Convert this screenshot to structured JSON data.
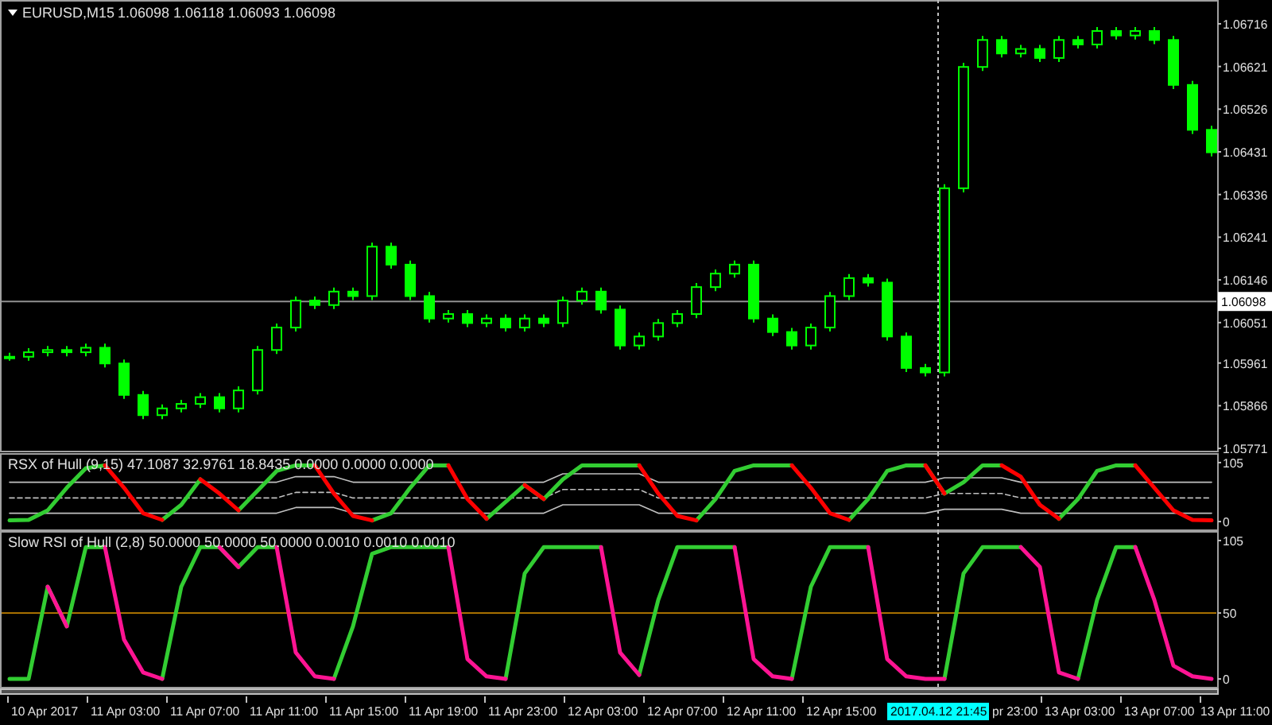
{
  "price_pane": {
    "symbol": "EURUSD,M15",
    "quote": "1.06098 1.06118 1.06093 1.06098",
    "chart_data": {
      "type": "candlestick",
      "ylim": [
        1.05764,
        1.06769
      ],
      "ohlc": [
        [
          1.05975,
          1.05984,
          1.05966,
          1.05975
        ],
        [
          1.05975,
          1.05994,
          1.05966,
          1.05985
        ],
        [
          1.05985,
          1.05999,
          1.05976,
          1.0599
        ],
        [
          1.0599,
          1.05999,
          1.05976,
          1.05985
        ],
        [
          1.05985,
          1.06004,
          1.05976,
          1.05995
        ],
        [
          1.05995,
          1.06004,
          1.05951,
          1.0596
        ],
        [
          1.0596,
          1.05969,
          1.05881,
          1.0589
        ],
        [
          1.0589,
          1.05899,
          1.05836,
          1.05845
        ],
        [
          1.05845,
          1.05869,
          1.05836,
          1.0586
        ],
        [
          1.0586,
          1.05879,
          1.05851,
          1.0587
        ],
        [
          1.0587,
          1.05894,
          1.05861,
          1.05885
        ],
        [
          1.05885,
          1.05894,
          1.05851,
          1.0586
        ],
        [
          1.0586,
          1.05909,
          1.05851,
          1.059
        ],
        [
          1.059,
          1.05999,
          1.05891,
          1.0599
        ],
        [
          1.0599,
          1.06049,
          1.05981,
          1.0604
        ],
        [
          1.0604,
          1.06109,
          1.06031,
          1.061
        ],
        [
          1.061,
          1.06109,
          1.06081,
          1.0609
        ],
        [
          1.0609,
          1.06129,
          1.06081,
          1.0612
        ],
        [
          1.0612,
          1.06129,
          1.06101,
          1.0611
        ],
        [
          1.0611,
          1.06229,
          1.06101,
          1.0622
        ],
        [
          1.0622,
          1.06229,
          1.06171,
          1.0618
        ],
        [
          1.0618,
          1.06189,
          1.06101,
          1.0611
        ],
        [
          1.0611,
          1.06119,
          1.06051,
          1.0606
        ],
        [
          1.0606,
          1.06079,
          1.06051,
          1.0607
        ],
        [
          1.0607,
          1.06079,
          1.06041,
          1.0605
        ],
        [
          1.0605,
          1.06069,
          1.06041,
          1.0606
        ],
        [
          1.0606,
          1.06069,
          1.06031,
          1.0604
        ],
        [
          1.0604,
          1.06069,
          1.06031,
          1.0606
        ],
        [
          1.0606,
          1.06069,
          1.06041,
          1.0605
        ],
        [
          1.0605,
          1.06109,
          1.06041,
          1.061
        ],
        [
          1.061,
          1.06129,
          1.06091,
          1.0612
        ],
        [
          1.0612,
          1.06129,
          1.06071,
          1.0608
        ],
        [
          1.0608,
          1.06089,
          1.05991,
          1.06
        ],
        [
          1.06,
          1.06029,
          1.05991,
          1.0602
        ],
        [
          1.0602,
          1.06059,
          1.06011,
          1.0605
        ],
        [
          1.0605,
          1.06079,
          1.06041,
          1.0607
        ],
        [
          1.0607,
          1.06139,
          1.06061,
          1.0613
        ],
        [
          1.0613,
          1.06169,
          1.06121,
          1.0616
        ],
        [
          1.0616,
          1.06189,
          1.06151,
          1.0618
        ],
        [
          1.0618,
          1.06189,
          1.06051,
          1.0606
        ],
        [
          1.0606,
          1.06069,
          1.06021,
          1.0603
        ],
        [
          1.0603,
          1.06039,
          1.05991,
          1.06
        ],
        [
          1.06,
          1.06049,
          1.05991,
          1.0604
        ],
        [
          1.0604,
          1.06119,
          1.06031,
          1.0611
        ],
        [
          1.0611,
          1.06159,
          1.06101,
          1.0615
        ],
        [
          1.0615,
          1.06159,
          1.06131,
          1.0614
        ],
        [
          1.0614,
          1.06149,
          1.06011,
          1.0602
        ],
        [
          1.0602,
          1.06029,
          1.05941,
          1.0595
        ],
        [
          1.0595,
          1.05959,
          1.05931,
          1.0594
        ],
        [
          1.0594,
          1.06359,
          1.05931,
          1.0635
        ],
        [
          1.0635,
          1.06629,
          1.06341,
          1.0662
        ],
        [
          1.0662,
          1.06689,
          1.06611,
          1.0668
        ],
        [
          1.0668,
          1.06689,
          1.06641,
          1.0665
        ],
        [
          1.0665,
          1.06669,
          1.06641,
          1.0666
        ],
        [
          1.0666,
          1.06669,
          1.06631,
          1.0664
        ],
        [
          1.0664,
          1.06689,
          1.06631,
          1.0668
        ],
        [
          1.0668,
          1.06689,
          1.06661,
          1.0667
        ],
        [
          1.0667,
          1.06709,
          1.06661,
          1.067
        ],
        [
          1.067,
          1.06709,
          1.06681,
          1.0669
        ],
        [
          1.0669,
          1.06709,
          1.06681,
          1.067
        ],
        [
          1.067,
          1.06709,
          1.06671,
          1.0668
        ],
        [
          1.0668,
          1.06689,
          1.06571,
          1.0658
        ],
        [
          1.0658,
          1.06589,
          1.06471,
          1.0648
        ],
        [
          1.0648,
          1.06489,
          1.06421,
          1.0643
        ]
      ],
      "yticks": [
        {
          "value": 1.06716,
          "label": "1.06716"
        },
        {
          "value": 1.06621,
          "label": "1.06621"
        },
        {
          "value": 1.06526,
          "label": "1.06526"
        },
        {
          "value": 1.06431,
          "label": "1.06431"
        },
        {
          "value": 1.06336,
          "label": "1.06336"
        },
        {
          "value": 1.06241,
          "label": "1.06241"
        },
        {
          "value": 1.06146,
          "label": "1.06146"
        },
        {
          "value": 1.06051,
          "label": "1.06051"
        },
        {
          "value": 1.05961,
          "label": "1.05961"
        },
        {
          "value": 1.05866,
          "label": "1.05866"
        },
        {
          "value": 1.05771,
          "label": "1.05771"
        }
      ],
      "ref_lines": [
        {
          "axis": "y",
          "value": 1.06098,
          "label": "1.06098"
        }
      ]
    }
  },
  "indicator_panes": [
    {
      "title": "RSX of Hull (9,15) 47.1087 32.9761 18.8435 0.0000 0.0000 0.0000",
      "chart_data": {
        "type": "line",
        "ylim": [
          -14,
          119
        ],
        "series": [
          {
            "color": "#c0c0c0",
            "line_style": "solid",
            "values": [
              70,
              70,
              70,
              70,
              70,
              70,
              70,
              70,
              70,
              70,
              70,
              70,
              70,
              70,
              70,
              80,
              80,
              80,
              70,
              70,
              70,
              70,
              70,
              70,
              70,
              70,
              70,
              70,
              70,
              85,
              85,
              85,
              85,
              85,
              70,
              70,
              70,
              70,
              70,
              70,
              70,
              70,
              70,
              70,
              70,
              70,
              70,
              70,
              70,
              78,
              78,
              78,
              78,
              70,
              70,
              70,
              70,
              70,
              70,
              70,
              70,
              70,
              70,
              70
            ]
          },
          {
            "color": "#c0c0c0",
            "line_style": "dashed",
            "values": [
              42,
              42,
              42,
              42,
              42,
              42,
              42,
              42,
              42,
              42,
              42,
              42,
              42,
              42,
              42,
              52,
              52,
              52,
              42,
              42,
              42,
              42,
              42,
              42,
              42,
              42,
              42,
              42,
              42,
              57,
              57,
              57,
              57,
              57,
              42,
              42,
              42,
              42,
              42,
              42,
              42,
              42,
              42,
              42,
              42,
              42,
              42,
              42,
              42,
              50,
              50,
              50,
              50,
              42,
              42,
              42,
              42,
              42,
              42,
              42,
              42,
              42,
              42,
              42
            ]
          },
          {
            "color": "#c0c0c0",
            "line_style": "solid",
            "values": [
              15,
              15,
              15,
              15,
              15,
              15,
              15,
              15,
              15,
              15,
              15,
              15,
              15,
              15,
              15,
              25,
              25,
              25,
              15,
              15,
              15,
              15,
              15,
              15,
              15,
              15,
              15,
              15,
              15,
              30,
              30,
              30,
              30,
              30,
              15,
              15,
              15,
              15,
              15,
              15,
              15,
              15,
              15,
              15,
              15,
              15,
              15,
              15,
              15,
              22,
              22,
              22,
              22,
              15,
              15,
              15,
              15,
              15,
              15,
              15,
              15,
              15,
              15,
              15
            ]
          },
          {
            "color": "#32cd32",
            "values": [
              2,
              3,
              20,
              60,
              95,
              100,
              null,
              null,
              3,
              30,
              75,
              null,
              20,
              55,
              90,
              100,
              100,
              null,
              null,
              2,
              15,
              60,
              100,
              100,
              null,
              5,
              35,
              65,
              40,
              75,
              100,
              100,
              100,
              100,
              null,
              null,
              2,
              40,
              90,
              100,
              100,
              100,
              null,
              null,
              3,
              40,
              90,
              100,
              100,
              50,
              70,
              100,
              100,
              null,
              null,
              5,
              40,
              90,
              100,
              100,
              null,
              null,
              null,
              null
            ]
          },
          {
            "color": "#ff0000",
            "values": [
              null,
              null,
              null,
              null,
              null,
              100,
              60,
              15,
              3,
              null,
              75,
              50,
              20,
              null,
              null,
              null,
              100,
              50,
              10,
              2,
              null,
              null,
              null,
              100,
              40,
              5,
              null,
              65,
              40,
              null,
              null,
              null,
              null,
              100,
              50,
              10,
              2,
              null,
              null,
              null,
              null,
              100,
              60,
              15,
              3,
              null,
              null,
              null,
              100,
              50,
              null,
              null,
              100,
              80,
              30,
              5,
              null,
              null,
              null,
              100,
              60,
              20,
              3,
              2
            ]
          }
        ],
        "yticks": [
          {
            "value": 105,
            "label": "105"
          },
          {
            "value": 0,
            "label": "0"
          }
        ]
      }
    },
    {
      "title": "Slow RSI of Hull (2,8) 50.0000 50.0000 50.0000 0.0010 0.0010 0.0010",
      "chart_data": {
        "type": "line",
        "ylim": [
          -6,
          111
        ],
        "series": [
          {
            "color": "#32cd32",
            "values": [
              0,
              0,
              70,
              40,
              100,
              100,
              null,
              null,
              0,
              70,
              100,
              100,
              85,
              100,
              100,
              null,
              null,
              0,
              40,
              95,
              100,
              100,
              100,
              100,
              null,
              null,
              0,
              80,
              100,
              100,
              100,
              100,
              null,
              3,
              60,
              100,
              100,
              100,
              100,
              null,
              null,
              0,
              70,
              100,
              100,
              100,
              null,
              null,
              null,
              0,
              80,
              100,
              100,
              100,
              null,
              null,
              0,
              60,
              100,
              100,
              null,
              null,
              null,
              null
            ]
          },
          {
            "color": "#ff1493",
            "values": [
              null,
              null,
              70,
              40,
              null,
              100,
              30,
              5,
              0,
              null,
              null,
              100,
              85,
              null,
              100,
              20,
              2,
              0,
              null,
              null,
              null,
              null,
              null,
              100,
              15,
              2,
              0,
              null,
              null,
              null,
              null,
              100,
              20,
              3,
              null,
              null,
              null,
              null,
              100,
              15,
              2,
              0,
              null,
              null,
              null,
              100,
              15,
              2,
              0,
              0,
              null,
              null,
              null,
              100,
              85,
              5,
              0,
              null,
              null,
              100,
              60,
              10,
              2,
              0
            ]
          }
        ],
        "yticks": [
          {
            "value": 105,
            "label": "105"
          },
          {
            "value": 50,
            "label": "50"
          },
          {
            "value": 0,
            "label": "0"
          }
        ],
        "ref_lines": [
          {
            "axis": "y",
            "value": 50
          }
        ]
      }
    }
  ],
  "time_axis": {
    "labels": [
      "10 Apr 2017",
      "11 Apr 03:00",
      "11 Apr 07:00",
      "11 Apr 11:00",
      "11 Apr 15:00",
      "11 Apr 19:00",
      "11 Apr 23:00",
      "12 Apr 03:00",
      "12 Apr 07:00",
      "12 Apr 11:00",
      "12 Apr 15:00",
      "pr 23:00",
      "13 Apr 03:00",
      "13 Apr 07:00",
      "13 Apr 11:00"
    ],
    "cursor_time": "2017.04.12 21:45"
  }
}
